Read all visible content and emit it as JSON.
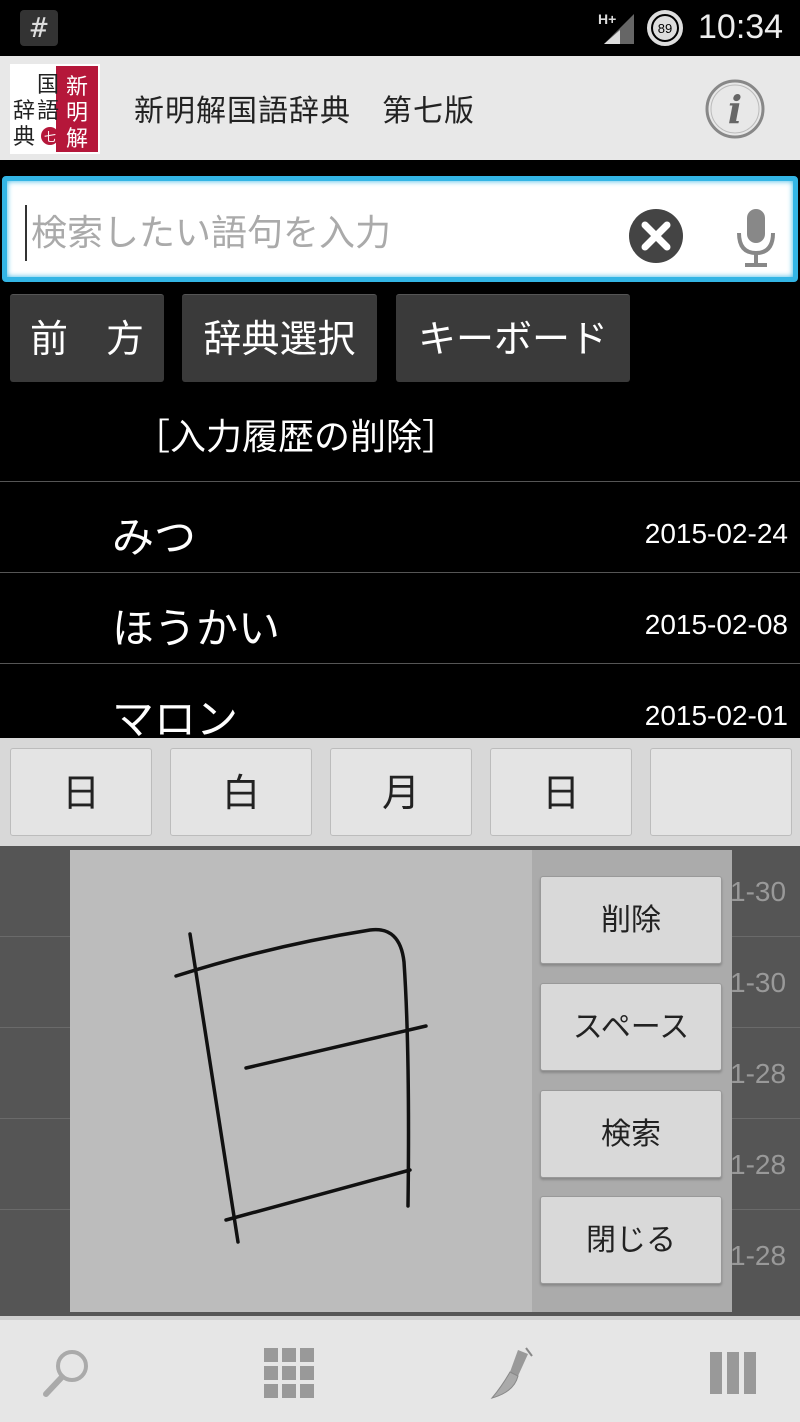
{
  "status_bar": {
    "hash_icon": "#",
    "network": "H+",
    "battery_level": "89",
    "time": "10:34"
  },
  "app_bar": {
    "logo_text": "新明解国語辞典 七",
    "title": "新明解国語辞典　第七版",
    "info_icon": "info-icon"
  },
  "search": {
    "placeholder": "検索したい語句を入力",
    "value": "",
    "clear_icon": "clear-icon",
    "mic_icon": "mic-icon",
    "accent_color": "#33b5e5"
  },
  "buttons": {
    "forward": "前　方",
    "dictionary_select": "辞典選択",
    "keyboard": "キーボード"
  },
  "history": {
    "clear_label": "［入力履歴の削除］",
    "items": [
      {
        "word": "みつ",
        "date": "2015-02-24"
      },
      {
        "word": "ほうかい",
        "date": "2015-02-08"
      },
      {
        "word": "マロン",
        "date": "2015-02-01"
      }
    ],
    "hidden_dates": [
      "1-30",
      "1-30",
      "1-28",
      "1-28",
      "1-28"
    ]
  },
  "candidates": [
    "日",
    "白",
    "月",
    "日",
    ""
  ],
  "handwriting": {
    "delete": "削除",
    "space": "スペース",
    "search": "検索",
    "close": "閉じる"
  },
  "bottom_nav": {
    "items": [
      "search-icon",
      "grid-icon",
      "brush-icon",
      "columns-icon"
    ]
  }
}
